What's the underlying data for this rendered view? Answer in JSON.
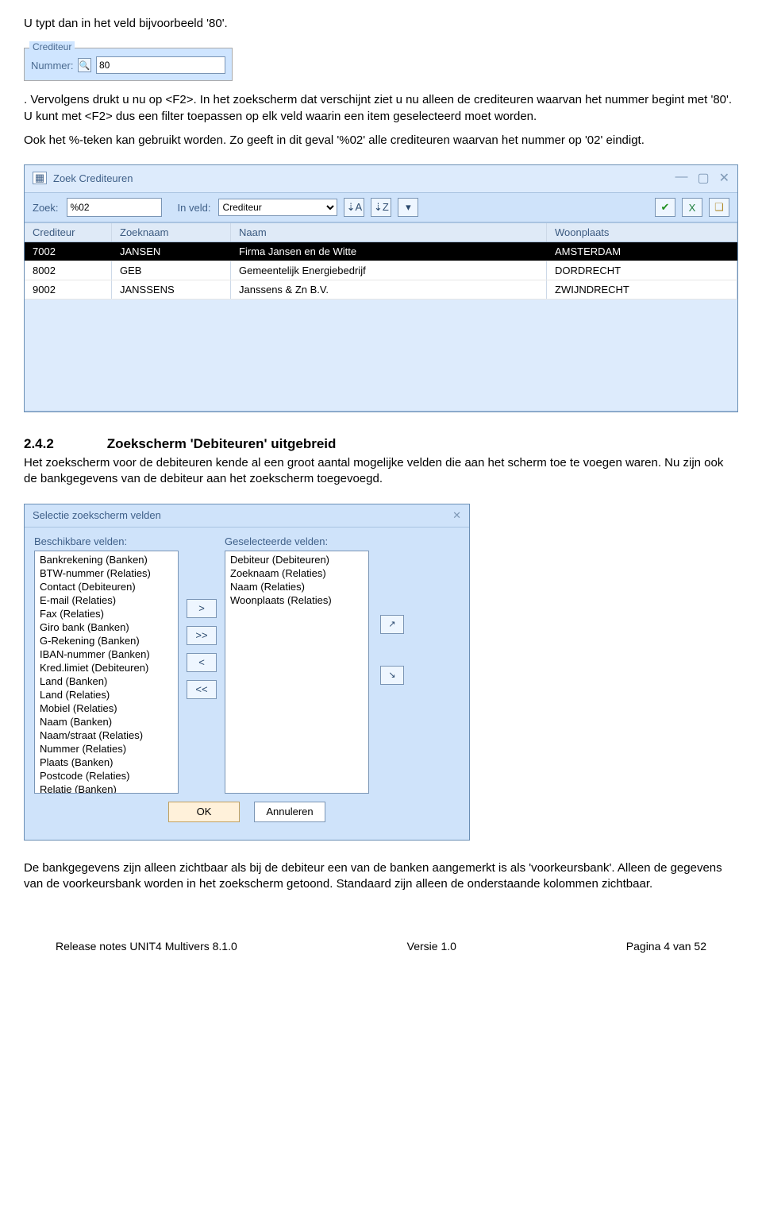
{
  "para1": "U typt dan in het veld bijvoorbeeld '80'.",
  "crediteur_snippet": {
    "legend": "Crediteur",
    "label": "Nummer:",
    "value": "80"
  },
  "para1b_a": ". Vervolgens drukt u nu op <F2>. In het zoekscherm dat verschijnt ziet u nu alleen de crediteuren waarvan het nummer begint met '80'. U kunt met <F2> dus een filter toepassen op elk veld waarin een item geselecteerd moet worden.",
  "para1b_b": "Ook het %-teken kan gebruikt worden. Zo geeft in dit geval '%02' alle crediteuren waarvan het nummer op '02' eindigt.",
  "search_window": {
    "title": "Zoek Crediteuren",
    "zoek_label": "Zoek:",
    "zoek_value": "%02",
    "inveld_label": "In veld:",
    "inveld_value": "Crediteur",
    "columns": [
      "Crediteur",
      "Zoeknaam",
      "Naam",
      "Woonplaats"
    ],
    "rows": [
      {
        "c": "7002",
        "z": "JANSEN",
        "n": "Firma Jansen en de Witte",
        "w": "AMSTERDAM",
        "sel": true
      },
      {
        "c": "8002",
        "z": "GEB",
        "n": "Gemeentelijk Energiebedrijf",
        "w": "DORDRECHT",
        "sel": false
      },
      {
        "c": "9002",
        "z": "JANSSENS",
        "n": "Janssens & Zn B.V.",
        "w": "ZWIJNDRECHT",
        "sel": false
      }
    ]
  },
  "heading": {
    "num": "2.4.2",
    "text": "Zoekscherm 'Debiteuren' uitgebreid"
  },
  "para2": "Het zoekscherm voor de debiteuren kende al een groot aantal mogelijke velden die aan het scherm toe te voegen waren. Nu zijn ook de bankgegevens van de debiteur aan het zoekscherm toegevoegd.",
  "dlg": {
    "title": "Selectie zoekscherm velden",
    "left_label": "Beschikbare velden:",
    "right_label": "Geselecteerde velden:",
    "left": [
      "Bankrekening (Banken)",
      "BTW-nummer (Relaties)",
      "Contact (Debiteuren)",
      "E-mail (Relaties)",
      "Fax (Relaties)",
      "Giro bank (Banken)",
      "G-Rekening (Banken)",
      "IBAN-nummer (Banken)",
      "Kred.limiet (Debiteuren)",
      "Land (Banken)",
      "Land (Relaties)",
      "Mobiel (Relaties)",
      "Naam (Banken)",
      "Naam/straat (Relaties)",
      "Nummer (Relaties)",
      "Plaats (Banken)",
      "Postcode (Relaties)",
      "Relatie (Banken)"
    ],
    "right": [
      "Debiteur (Debiteuren)",
      "Zoeknaam (Relaties)",
      "Naam (Relaties)",
      "Woonplaats (Relaties)"
    ],
    "btn_add": ">",
    "btn_add_all": ">>",
    "btn_remove": "<",
    "btn_remove_all": "<<",
    "btn_up": "↗",
    "btn_down": "↘",
    "ok": "OK",
    "cancel": "Annuleren"
  },
  "para3": "De bankgegevens zijn alleen zichtbaar als bij de debiteur een van de banken aangemerkt is als 'voorkeursbank'. Alleen de gegevens van de voorkeursbank worden in het zoekscherm getoond. Standaard zijn alleen de onderstaande kolommen zichtbaar.",
  "footer": {
    "left": "Release notes UNIT4 Multivers 8.1.0",
    "mid": "Versie 1.0",
    "right": "Pagina 4 van 52"
  }
}
